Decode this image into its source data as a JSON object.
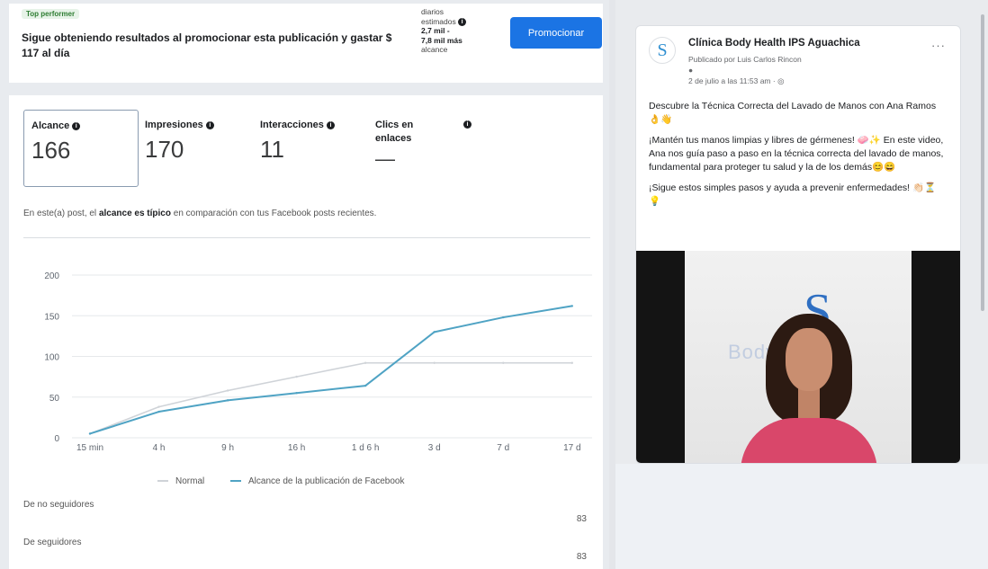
{
  "promotion": {
    "badge": "Top performer",
    "message": "Sigue obteniendo resultados al promocionar esta publicación y gastar $ 117 al día",
    "estimate_line1": "diarios",
    "estimate_line2": "estimados",
    "estimate_value": "2,7 mil -",
    "estimate_value2": "7,8 mil más",
    "estimate_line3": "alcance",
    "button_label": "Promocionar"
  },
  "metrics": [
    {
      "label": "Alcance",
      "value": "166"
    },
    {
      "label": "Impresiones",
      "value": "170"
    },
    {
      "label": "Interacciones",
      "value": "11"
    },
    {
      "label": "Clics en enlaces",
      "value": "—"
    }
  ],
  "description": {
    "prefix": "En este(a) post, el",
    "highlight": "alcance es típico",
    "suffix": "en comparación con tus Facebook posts recientes."
  },
  "chart_data": {
    "type": "line",
    "x": [
      "15 min",
      "4 h",
      "9 h",
      "16 h",
      "1 d 6 h",
      "3 d",
      "7 d",
      "17 d"
    ],
    "ylim": [
      0,
      200
    ],
    "yticks": [
      0,
      50,
      100,
      150,
      200
    ],
    "series": [
      {
        "name": "Normal",
        "color": "#cfd3d8",
        "values": [
          5,
          38,
          58,
          75,
          92,
          92,
          92,
          92
        ]
      },
      {
        "name": "Alcance de la publicación de Facebook",
        "color": "#4fa3c4",
        "values": [
          5,
          32,
          46,
          55,
          64,
          130,
          148,
          162
        ]
      }
    ],
    "grid": true,
    "legend": "bottom"
  },
  "breakdown": [
    {
      "label": "De no seguidores",
      "value": "83"
    },
    {
      "label": "De seguidores",
      "value": "83"
    }
  ],
  "post": {
    "page_name": "Clínica Body Health IPS Aguachica",
    "published_by": "Publicado por Luis Carlos Rincon",
    "date": "2 de julio a las 11:53 am",
    "paragraph1": "Descubre la Técnica Correcta del Lavado de Manos con Ana Ramos 👌👋",
    "paragraph2": "¡Mantén tus manos limpias y libres de gérmenes! 🧼✨ En este video, Ana nos guía paso a paso en la técnica correcta del lavado de manos, fundamental para proteger tu salud y la de los demás😊😄",
    "paragraph3": "¡Sigue estos simples pasos y ayuda a prevenir enfermedades! 👏🏻⏳💡",
    "video_brand": "Body Health"
  },
  "colors": {
    "primary_button": "#1b74e4",
    "reach_line": "#4fa3c4",
    "normal_line": "#cfd3d8"
  }
}
